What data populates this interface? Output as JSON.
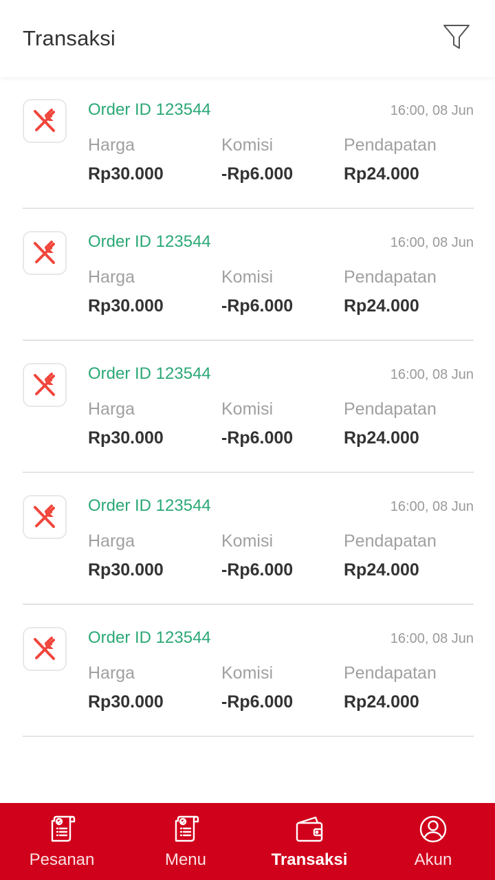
{
  "header": {
    "title": "Transaksi",
    "filter_icon": "filter-icon"
  },
  "labels": {
    "harga": "Harga",
    "komisi": "Komisi",
    "pendapatan": "Pendapatan"
  },
  "colors": {
    "accent_red": "#d0021b",
    "order_green": "#2aa876",
    "icon_red": "#f0463c"
  },
  "transactions": [
    {
      "icon": "restaurant-icon",
      "order_id": "Order ID 123544",
      "time": "16:00, 08 Jun",
      "harga": "Rp30.000",
      "komisi": "-Rp6.000",
      "pendapatan": "Rp24.000"
    },
    {
      "icon": "restaurant-icon",
      "order_id": "Order ID 123544",
      "time": "16:00, 08 Jun",
      "harga": "Rp30.000",
      "komisi": "-Rp6.000",
      "pendapatan": "Rp24.000"
    },
    {
      "icon": "restaurant-icon",
      "order_id": "Order ID 123544",
      "time": "16:00, 08 Jun",
      "harga": "Rp30.000",
      "komisi": "-Rp6.000",
      "pendapatan": "Rp24.000"
    },
    {
      "icon": "restaurant-icon",
      "order_id": "Order ID 123544",
      "time": "16:00, 08 Jun",
      "harga": "Rp30.000",
      "komisi": "-Rp6.000",
      "pendapatan": "Rp24.000"
    },
    {
      "icon": "restaurant-icon",
      "order_id": "Order ID 123544",
      "time": "16:00, 08 Jun",
      "harga": "Rp30.000",
      "komisi": "-Rp6.000",
      "pendapatan": "Rp24.000"
    }
  ],
  "nav": [
    {
      "label": "Pesanan",
      "icon": "order-list-icon",
      "active": false
    },
    {
      "label": "Menu",
      "icon": "menu-list-icon",
      "active": false
    },
    {
      "label": "Transaksi",
      "icon": "wallet-icon",
      "active": true
    },
    {
      "label": "Akun",
      "icon": "account-icon",
      "active": false
    }
  ]
}
